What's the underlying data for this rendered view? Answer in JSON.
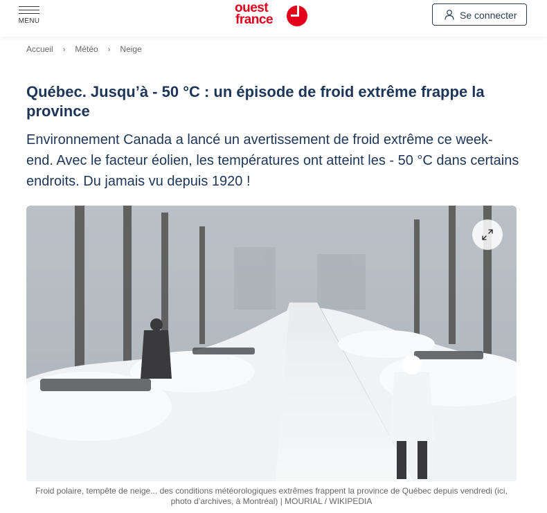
{
  "header": {
    "menu_label": "MENU",
    "logo_line1": "ouest",
    "logo_line2": "france",
    "login_label": "Se connecter",
    "brand_color": "#e2001a"
  },
  "breadcrumb": {
    "items": [
      "Accueil",
      "Météo",
      "Neige"
    ]
  },
  "article": {
    "title": "Québec. Jusqu’à - 50 °C : un épisode de froid extrême frappe la province",
    "lead": "Environnement Canada a lancé un avertissement de froid extrême ce week-end. Avec le facteur éolien, les températures ont atteint les - 50 °C dans certains endroits. Du jamais vu depuis 1920 !",
    "image": {
      "alt": "",
      "caption": "Froid polaire, tempête de neige... des conditions météorologiques extrêmes frappent la province de Québec depuis vendredi (ici, photo d’archives, à Montréal) | MOURIAL / WIKIPEDIA"
    }
  },
  "icons": {
    "menu": "hamburger-icon",
    "user": "user-icon",
    "breadcrumb_separator": "chevron-right-icon",
    "expand": "expand-icon"
  },
  "colors": {
    "title": "#1d3557",
    "button_border": "#2a3b56"
  }
}
